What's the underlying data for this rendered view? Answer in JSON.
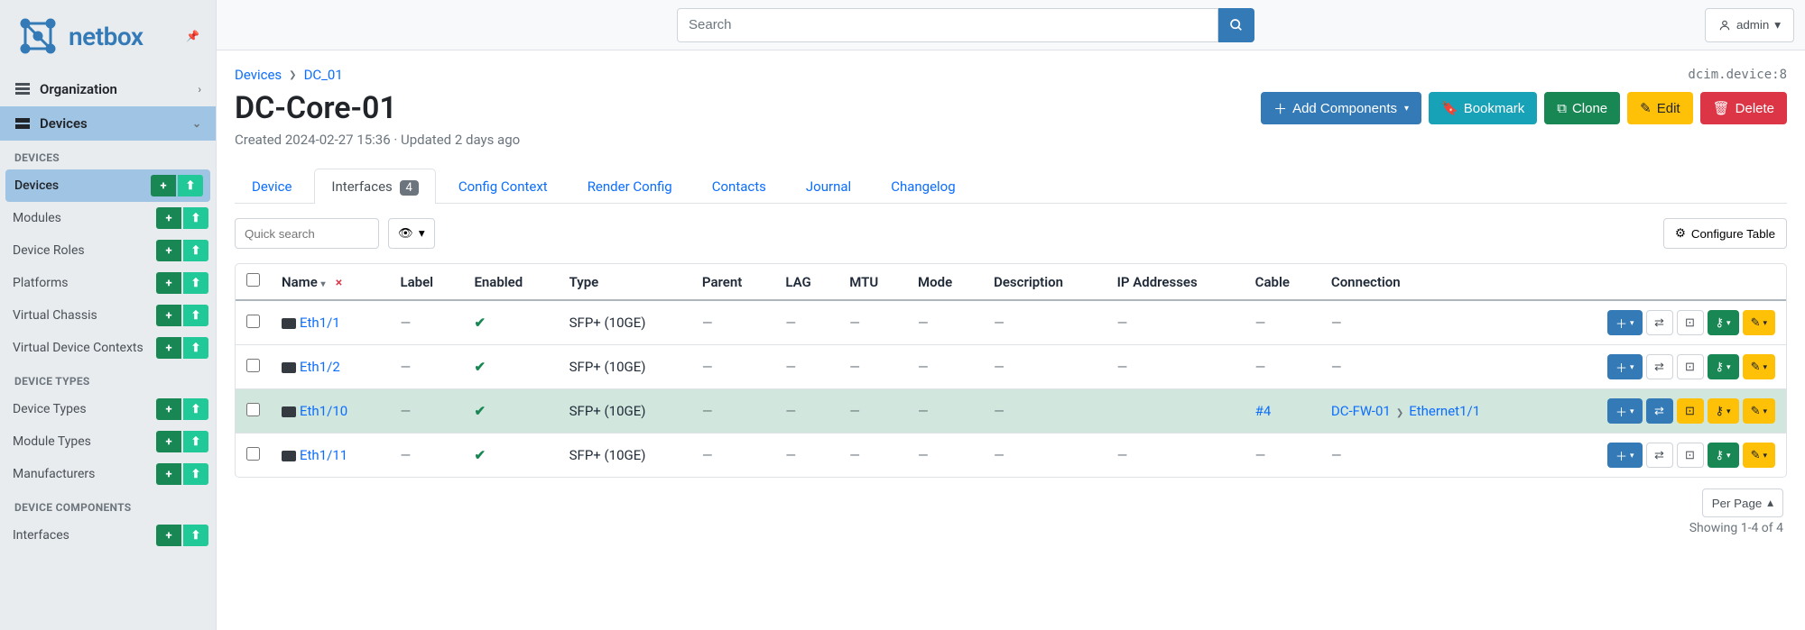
{
  "brand": "netbox",
  "search": {
    "placeholder": "Search"
  },
  "user": {
    "label": "admin"
  },
  "sidebar": {
    "groups": [
      {
        "label": "Organization",
        "expanded": false
      },
      {
        "label": "Devices",
        "expanded": true
      }
    ],
    "sections": [
      {
        "heading": "DEVICES",
        "items": [
          {
            "label": "Devices",
            "selected": true
          },
          {
            "label": "Modules"
          },
          {
            "label": "Device Roles"
          },
          {
            "label": "Platforms"
          },
          {
            "label": "Virtual Chassis"
          },
          {
            "label": "Virtual Device Contexts"
          }
        ]
      },
      {
        "heading": "DEVICE TYPES",
        "items": [
          {
            "label": "Device Types"
          },
          {
            "label": "Module Types"
          },
          {
            "label": "Manufacturers"
          }
        ]
      },
      {
        "heading": "DEVICE COMPONENTS",
        "items": [
          {
            "label": "Interfaces"
          }
        ]
      }
    ]
  },
  "breadcrumb": {
    "root": "Devices",
    "current": "DC_01"
  },
  "object_id": "dcim.device:8",
  "page_title": "DC-Core-01",
  "meta": "Created 2024-02-27 15:36 · Updated 2 days ago",
  "actions": {
    "add_components": "Add Components",
    "bookmark": "Bookmark",
    "clone": "Clone",
    "edit": "Edit",
    "delete": "Delete"
  },
  "tabs": [
    {
      "label": "Device"
    },
    {
      "label": "Interfaces",
      "count": "4",
      "active": true
    },
    {
      "label": "Config Context"
    },
    {
      "label": "Render Config"
    },
    {
      "label": "Contacts"
    },
    {
      "label": "Journal"
    },
    {
      "label": "Changelog"
    }
  ],
  "quick_search_placeholder": "Quick search",
  "configure_table": "Configure Table",
  "columns": {
    "name": "Name",
    "label": "Label",
    "enabled": "Enabled",
    "type": "Type",
    "parent": "Parent",
    "lag": "LAG",
    "mtu": "MTU",
    "mode": "Mode",
    "description": "Description",
    "ip": "IP Addresses",
    "cable": "Cable",
    "connection": "Connection"
  },
  "rows": [
    {
      "name": "Eth1/1",
      "label": "—",
      "enabled": true,
      "type": "SFP+ (10GE)",
      "parent": "—",
      "lag": "—",
      "mtu": "—",
      "mode": "—",
      "description": "—",
      "ip": "—",
      "cable": null,
      "conn_device": null,
      "conn_iface": null,
      "highlight": false,
      "trace_linked": false
    },
    {
      "name": "Eth1/2",
      "label": "—",
      "enabled": true,
      "type": "SFP+ (10GE)",
      "parent": "—",
      "lag": "—",
      "mtu": "—",
      "mode": "—",
      "description": "—",
      "ip": "—",
      "cable": null,
      "conn_device": null,
      "conn_iface": null,
      "highlight": false,
      "trace_linked": false
    },
    {
      "name": "Eth1/10",
      "label": "—",
      "enabled": true,
      "type": "SFP+ (10GE)",
      "parent": "—",
      "lag": "—",
      "mtu": "—",
      "mode": "—",
      "description": "—",
      "ip": "",
      "cable": "#4",
      "conn_device": "DC-FW-01",
      "conn_iface": "Ethernet1/1",
      "highlight": true,
      "trace_linked": true
    },
    {
      "name": "Eth1/11",
      "label": "—",
      "enabled": true,
      "type": "SFP+ (10GE)",
      "parent": "—",
      "lag": "—",
      "mtu": "—",
      "mode": "—",
      "description": "—",
      "ip": "—",
      "cable": null,
      "conn_device": null,
      "conn_iface": null,
      "highlight": false,
      "trace_linked": false
    }
  ],
  "per_page": "Per Page",
  "showing": "Showing 1-4 of 4"
}
